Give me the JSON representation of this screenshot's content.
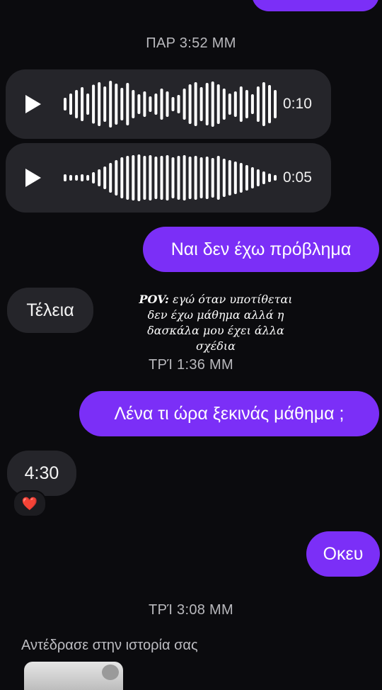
{
  "chat": {
    "timestamp1": "ΠΑΡ 3:52 ΜΜ",
    "voice1_duration": "0:10",
    "voice2_duration": "0:05",
    "msg_out1": "Ναι δεν έχω πρόβλημα",
    "msg_in1": "Τέλεια",
    "timestamp2": "ΤΡΊ 1:36 ΜΜ",
    "msg_out2": "Λένα τι ώρα ξεκινάς μάθημα ;",
    "msg_in2": "4:30",
    "reaction": "❤️",
    "msg_out3": "Οκευ",
    "timestamp3": "ΤΡΊ 3:08 ΜΜ",
    "story_reply_label": "Αντέδρασε στην ιστορία σας"
  },
  "overlay": {
    "prefix": "POV:",
    "line1": "εγώ όταν υποτίθεται",
    "line2": "δεν έχω μάθημα αλλά η",
    "line3": "δασκάλα μου έχει άλλα",
    "line4": "σχέδια"
  },
  "colors": {
    "background": "#0b0b0e",
    "outgoing_bubble": "#7b2ff7",
    "incoming_bubble": "#25252a"
  }
}
